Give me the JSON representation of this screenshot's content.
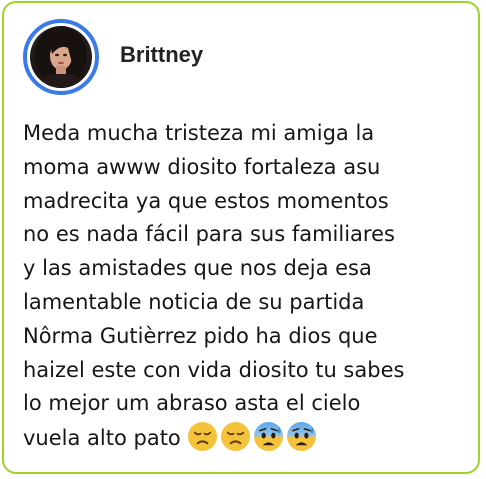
{
  "post": {
    "username": "Brittney",
    "avatar_alt": "profile photo",
    "message_lines": [
      "Meda mucha tristeza mi amiga la",
      "moma awww diosito fortaleza asu",
      "madrecita ya que estos momentos",
      "no es nada fácil para sus familiares",
      "y las amistades que nos deja esa",
      "lamentable noticia de su partida",
      "Nôrma Gutièrrez pido ha dios que",
      "haizel este con vida diosito tu sabes",
      "lo mejor um abraso asta el cielo",
      "vuela alto pato"
    ],
    "emojis": [
      "disappointed-face-icon",
      "disappointed-face-icon",
      "anxious-face-with-sweat-icon",
      "anxious-face-with-sweat-icon"
    ]
  },
  "colors": {
    "card_border": "#9fd22a",
    "avatar_ring": "#3b7be8",
    "text": "#161616",
    "emoji_yellow": "#f5c33b",
    "emoji_blue": "#5aa6e6"
  }
}
